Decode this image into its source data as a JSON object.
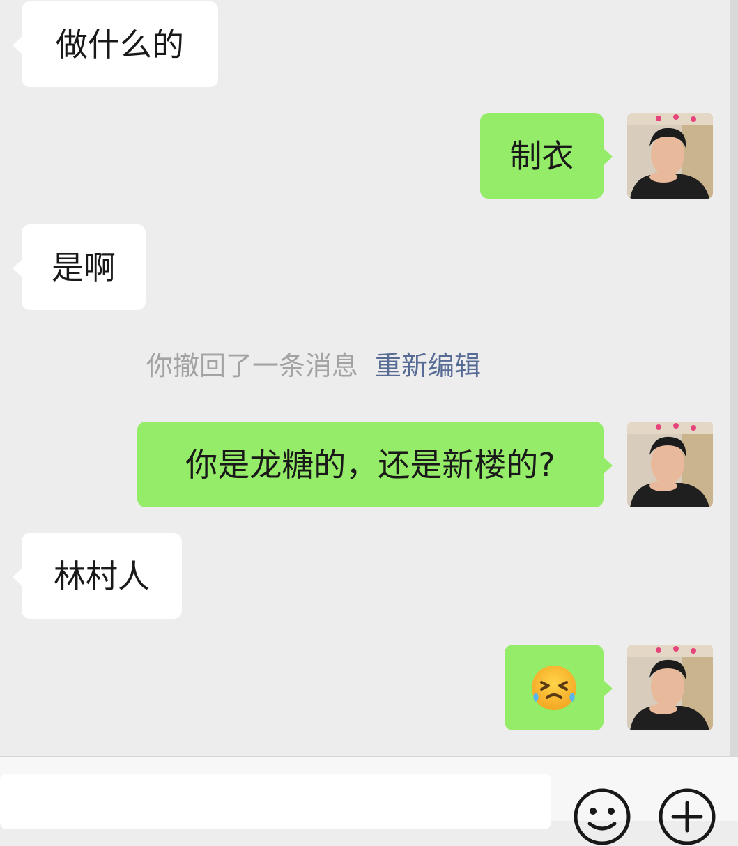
{
  "messages": [
    {
      "direction": "incoming",
      "text": "做什么的"
    },
    {
      "direction": "outgoing",
      "text": "制衣"
    },
    {
      "direction": "incoming",
      "text": "是啊"
    },
    {
      "direction": "outgoing",
      "text": "你是龙糖的，还是新楼的?"
    },
    {
      "direction": "incoming",
      "text": "林村人"
    },
    {
      "direction": "outgoing",
      "emoji": "grinning-squinting-tears-emoji"
    }
  ],
  "system_notice": {
    "text": "你撤回了一条消息",
    "action_label": "重新编辑"
  },
  "input_bar": {
    "placeholder": "",
    "emoji_button_icon": "smiley-icon",
    "more_button_icon": "plus-circle-icon"
  },
  "colors": {
    "chat_background": "#ededed",
    "incoming_bubble": "#ffffff",
    "outgoing_bubble": "#95ec69",
    "system_text": "#a3a3a3",
    "link": "#576b95"
  }
}
